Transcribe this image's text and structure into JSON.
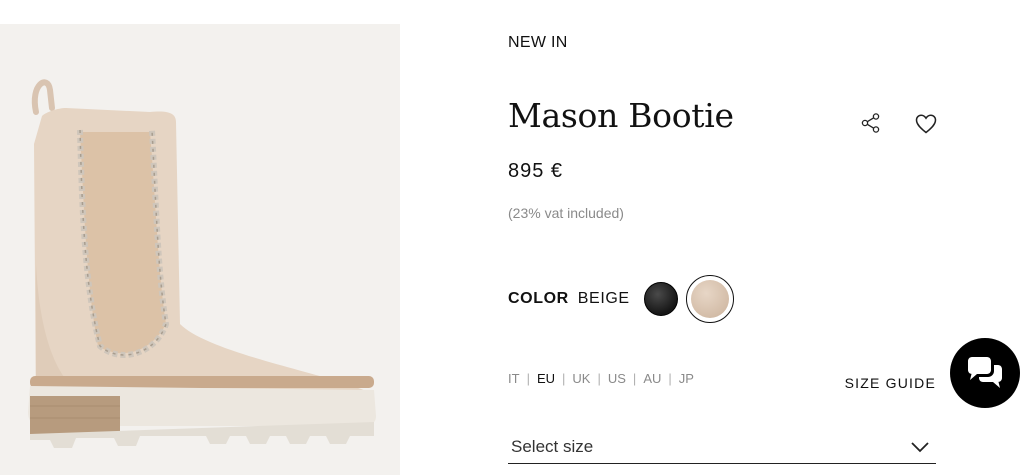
{
  "product": {
    "badge": "NEW IN",
    "name": "Mason Bootie",
    "price": "895 €",
    "vat_note": "(23% vat included)",
    "image_icon": "boot-photo"
  },
  "color": {
    "label": "COLOR",
    "selected": "BEIGE",
    "swatches": [
      {
        "name": "black",
        "hex": "#1e1e1e",
        "selected": false
      },
      {
        "name": "beige",
        "hex": "#dcc7b4",
        "selected": true
      }
    ]
  },
  "sizes": {
    "systems": [
      "IT",
      "EU",
      "UK",
      "US",
      "AU",
      "JP"
    ],
    "active_system": "EU",
    "size_guide_label": "SIZE GUIDE",
    "select_placeholder": "Select size"
  },
  "icons": {
    "share": "share-icon",
    "wishlist": "heart-icon",
    "dropdown": "chevron-down-icon",
    "chat": "chat-icon"
  }
}
